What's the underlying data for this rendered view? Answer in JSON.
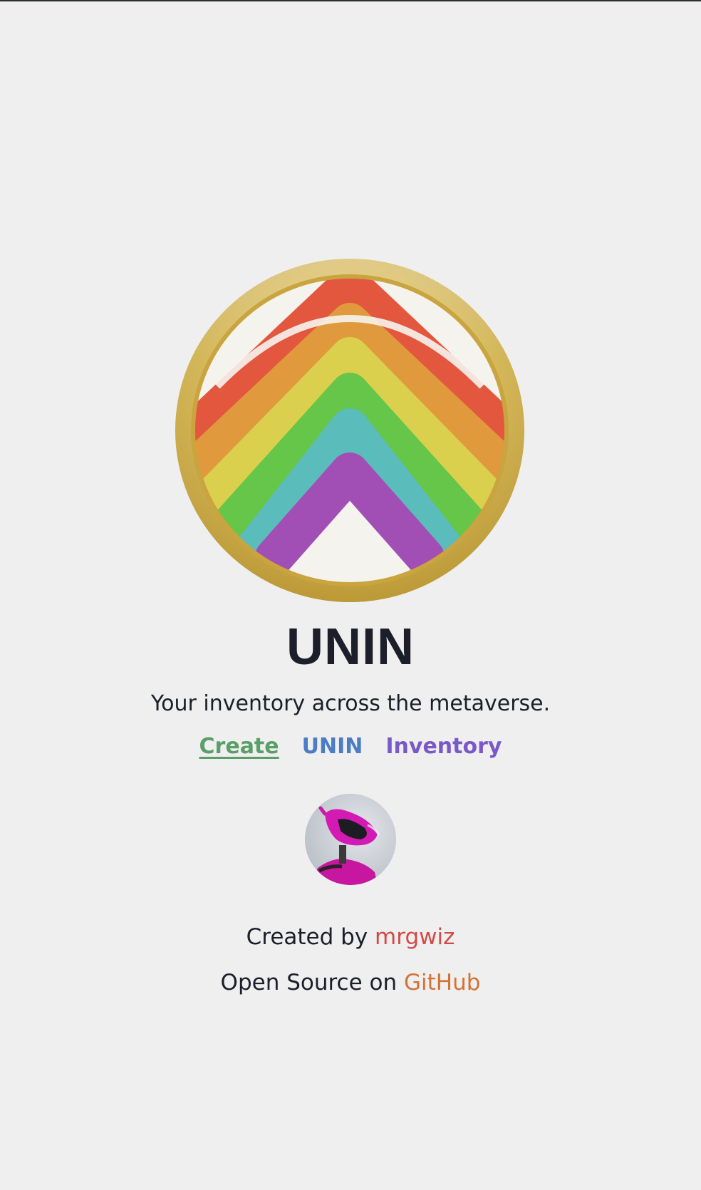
{
  "app": {
    "logo_icon": "rainbow-arch-coin-logo",
    "title": "UNIN",
    "tagline": "Your inventory across the metaverse."
  },
  "nav": {
    "links": [
      {
        "label": "Create",
        "color": "#5a9e68",
        "active": true
      },
      {
        "label": "UNIN",
        "color": "#4a7dc4"
      },
      {
        "label": "Inventory",
        "color": "#7b58c8"
      }
    ]
  },
  "creator": {
    "avatar_icon": "pink-robot-avatar",
    "created_prefix": "Created by ",
    "author_name": "mrgwiz",
    "author_color": "#d24a46",
    "source_prefix": "Open Source on ",
    "source_link": "GitHub",
    "source_color": "#d07335"
  },
  "colors": {
    "background": "#efefef",
    "text": "#1c1f2a",
    "rainbow": [
      "#e2573e",
      "#e09a3d",
      "#dbd04d",
      "#66c64a",
      "#5bbcbc",
      "#a14fb5"
    ],
    "gold_ring": "#d3b24c"
  }
}
